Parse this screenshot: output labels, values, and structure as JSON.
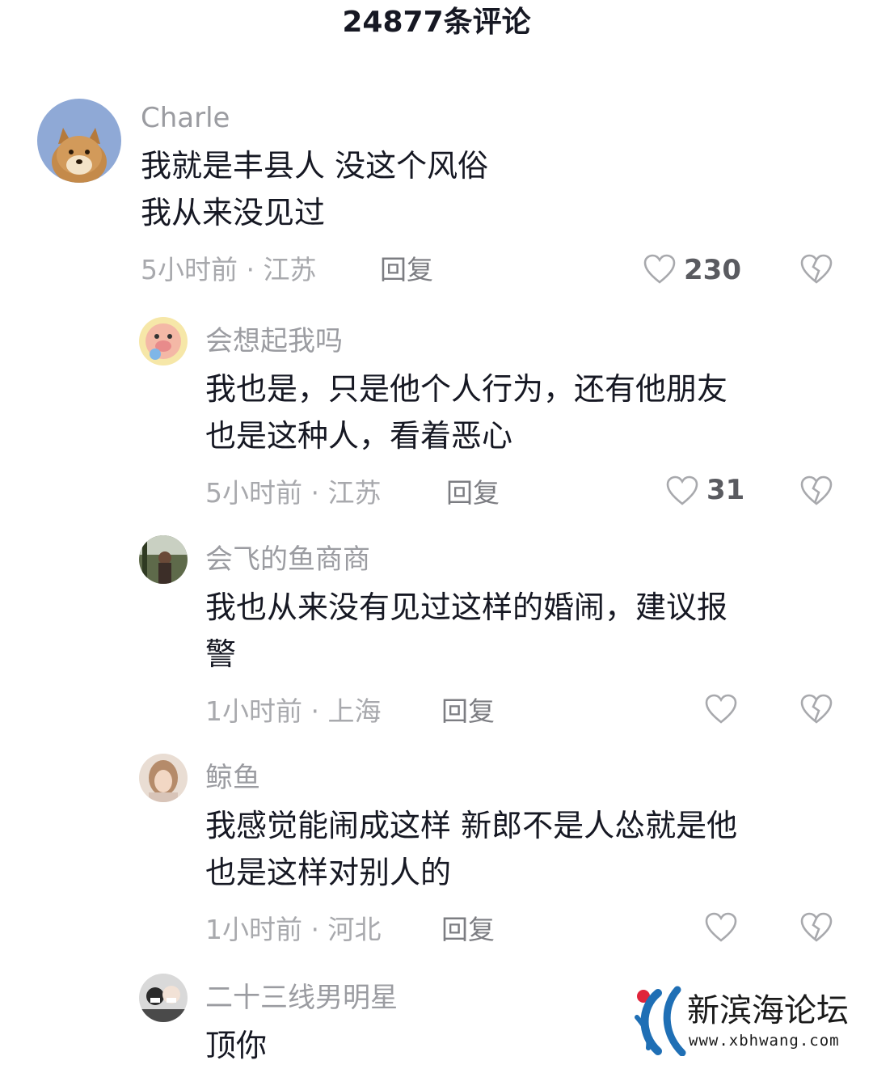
{
  "header": {
    "title": "24877条评论"
  },
  "comments": [
    {
      "username": "Charle",
      "lines": [
        "我就是丰县人  没这个风俗",
        "我从来没见过"
      ],
      "meta": "5小时前 · 江苏",
      "reply_label": "回复",
      "likes": "230",
      "avatar_icon": "shiba-dog-avatar"
    },
    {
      "username": "会想起我吗",
      "lines": [
        "我也是，只是他个人行为，还有他朋友",
        "也是这种人，看着恶心"
      ],
      "meta": "5小时前 · 江苏",
      "reply_label": "回复",
      "likes": "31",
      "avatar_icon": "cartoon-pig-avatar"
    },
    {
      "username": "会飞的鱼商商",
      "lines": [
        "我也从来没有见过这样的婚闹，建议报",
        "警"
      ],
      "meta": "1小时前 · 上海",
      "reply_label": "回复",
      "likes": "",
      "avatar_icon": "photo-avatar"
    },
    {
      "username": "鲸鱼",
      "lines": [
        "我感觉能闹成这样 新郎不是人怂就是他",
        "也是这样对别人的"
      ],
      "meta": "1小时前 · 河北",
      "reply_label": "回复",
      "likes": "",
      "avatar_icon": "girl-photo-avatar"
    },
    {
      "username": "二十三线男明星",
      "lines": [
        "顶你"
      ],
      "meta": "",
      "reply_label": "",
      "likes": "",
      "avatar_icon": "couple-photo-avatar"
    }
  ],
  "watermark": {
    "title": "新滨海论坛",
    "url": "www.xbhwang.com",
    "logo_icon": "xbh-logo"
  },
  "colors": {
    "text_primary": "#161823",
    "text_secondary": "#9b9ca1",
    "icon_gray": "#a8a9ad",
    "logo_blue": "#1f6fb5",
    "logo_red": "#e0243b"
  }
}
